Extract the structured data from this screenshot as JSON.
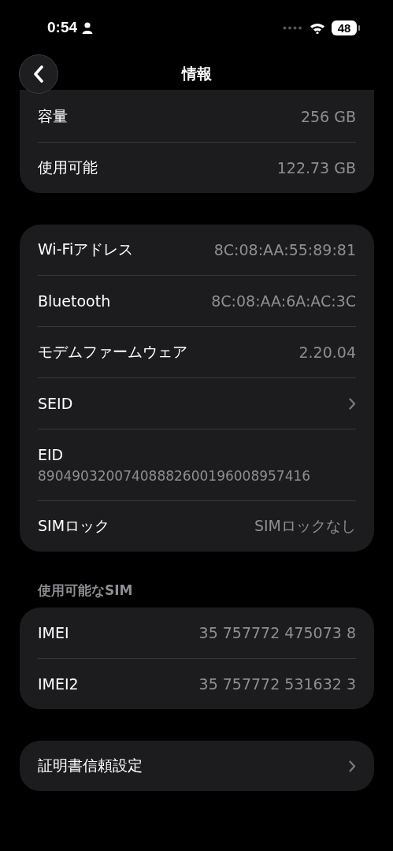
{
  "status_bar": {
    "time": "0:54",
    "battery": "48"
  },
  "nav": {
    "title": "情報"
  },
  "groups": [
    {
      "top_cut": true,
      "rows": [
        {
          "kind": "value",
          "label": "容量",
          "value": "256 GB"
        },
        {
          "kind": "value",
          "label": "使用可能",
          "value": "122.73 GB"
        }
      ]
    },
    {
      "rows": [
        {
          "kind": "value",
          "label": "Wi-Fiアドレス",
          "value": "8C:08:AA:55:89:81"
        },
        {
          "kind": "value",
          "label": "Bluetooth",
          "value": "8C:08:AA:6A:AC:3C"
        },
        {
          "kind": "value",
          "label": "モデムファームウェア",
          "value": "2.20.04"
        },
        {
          "kind": "chevron",
          "label": "SEID"
        },
        {
          "kind": "stacked",
          "label": "EID",
          "value": "89049032007408882600196008957416"
        },
        {
          "kind": "value",
          "label": "SIMロック",
          "value": "SIMロックなし"
        }
      ]
    },
    {
      "header": "使用可能なSIM",
      "rows": [
        {
          "kind": "value",
          "label": "IMEI",
          "value": "35 757772 475073 8"
        },
        {
          "kind": "value",
          "label": "IMEI2",
          "value": "35 757772 531632 3"
        }
      ]
    },
    {
      "rows": [
        {
          "kind": "chevron",
          "label": "証明書信頼設定"
        }
      ]
    }
  ]
}
